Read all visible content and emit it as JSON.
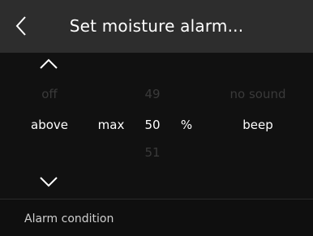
{
  "header": {
    "title": "Set moisture alarm...",
    "back_icon": "chevron-left-icon"
  },
  "picker": {
    "up_icon": "chevron-up-icon",
    "down_icon": "chevron-down-icon",
    "condition": {
      "above": "off",
      "selected": "above"
    },
    "limit": {
      "selected": "max"
    },
    "value": {
      "above": "49",
      "selected": "50",
      "below": "51"
    },
    "unit": {
      "selected": "%"
    },
    "sound": {
      "above": "no sound",
      "selected": "beep"
    }
  },
  "footer": {
    "label": "Alarm condition"
  },
  "colors": {
    "header_bg": "#2d2d2d",
    "picker_bg": "#111111",
    "selected_text": "#ffffff",
    "dim_text": "#3a3a3a"
  }
}
